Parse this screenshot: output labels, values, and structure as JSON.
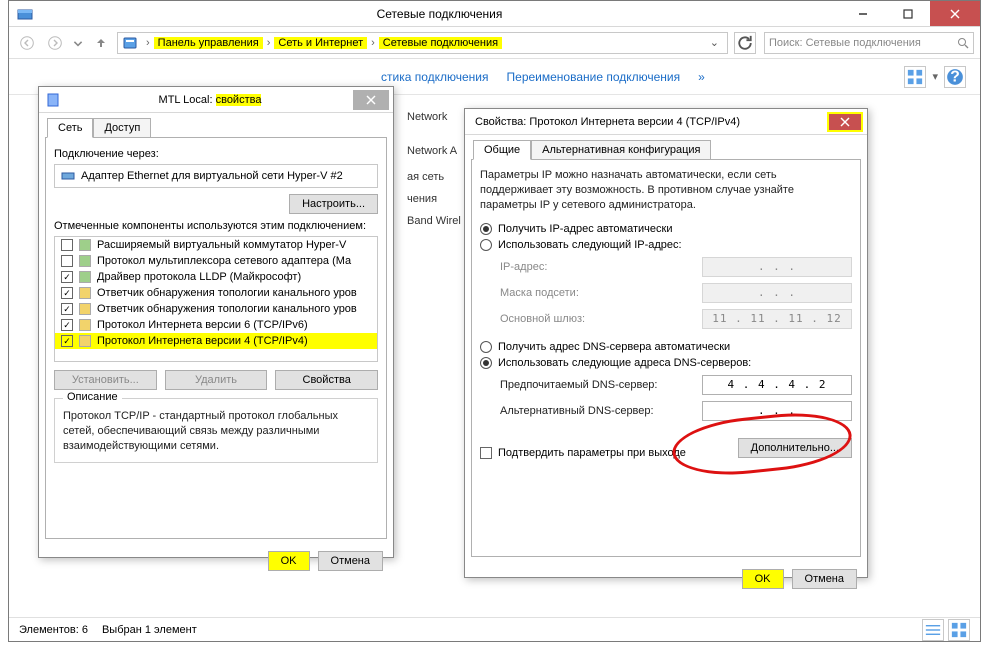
{
  "explorer": {
    "title": "Сетевые подключения",
    "breadcrumbs": [
      "Панель управления",
      "Сеть и Интернет",
      "Сетевые подключения"
    ],
    "search_placeholder": "Поиск: Сетевые подключения",
    "commands": {
      "diag_suffix": "стика подключения",
      "rename": "Переименование подключения"
    },
    "columns": {
      "c1": "Network",
      "c2": "Network A",
      "c3": "ая сеть",
      "c4": "чения",
      "c5": "Band Wirel"
    },
    "status": {
      "count": "Элементов: 6",
      "selected": "Выбран 1 элемент"
    }
  },
  "dlg1": {
    "title_prefix": "MTL Local: ",
    "title_hl": "свойства",
    "tabs": {
      "net": "Сеть",
      "access": "Доступ"
    },
    "connect_via": "Подключение через:",
    "adapter": "Адаптер Ethernet для виртуальной сети Hyper-V #2",
    "configure": "Настроить...",
    "components_label": "Отмеченные компоненты используются этим подключением:",
    "items": [
      {
        "checked": false,
        "style": "g",
        "label": "Расширяемый виртуальный коммутатор Hyper-V"
      },
      {
        "checked": false,
        "style": "g",
        "label": "Протокол мультиплексора сетевого адаптера (Ма"
      },
      {
        "checked": true,
        "style": "g",
        "label": "Драйвер протокола LLDP (Майкрософт)"
      },
      {
        "checked": true,
        "style": "y",
        "label": "Ответчик обнаружения топологии канального уров"
      },
      {
        "checked": true,
        "style": "y",
        "label": "Ответчик обнаружения топологии канального уров"
      },
      {
        "checked": true,
        "style": "y",
        "label": "Протокол Интернета версии 6 (TCP/IPv6)"
      },
      {
        "checked": true,
        "style": "y",
        "label": "Протокол Интернета версии 4 (TCP/IPv4)"
      }
    ],
    "install": "Установить...",
    "remove": "Удалить",
    "props": "Свойства",
    "desc_title": "Описание",
    "desc": "Протокол TCP/IP - стандартный протокол глобальных сетей, обеспечивающий связь между различными взаимодействующими сетями.",
    "ok": "OK",
    "cancel": "Отмена"
  },
  "dlg2": {
    "title": "Свойства: Протокол Интернета версии 4 (TCP/IPv4)",
    "tabs": {
      "general": "Общие",
      "alt": "Альтернативная конфигурация"
    },
    "intro": "Параметры IP можно назначать автоматически, если сеть поддерживает эту возможность. В противном случае узнайте параметры IP у сетевого администратора.",
    "r_ip_auto": "Получить IP-адрес автоматически",
    "r_ip_manual": "Использовать следующий IP-адрес:",
    "ip_label": "IP-адрес:",
    "mask_label": "Маска подсети:",
    "gw_label": "Основной шлюз:",
    "ip_val": ".       .       .",
    "mask_val": ".       .       .",
    "gw_val": "11 . 11 . 11 . 12",
    "r_dns_auto": "Получить адрес DNS-сервера автоматически",
    "r_dns_manual": "Использовать следующие адреса DNS-серверов:",
    "dns1_label": "Предпочитаемый DNS-сервер:",
    "dns2_label": "Альтернативный DNS-сервер:",
    "dns1_val": "4 .  4  .  4  .  2",
    "dns2_val": ".       .       .",
    "validate": "Подтвердить параметры при выходе",
    "advanced": "Дополнительно...",
    "ok": "OK",
    "cancel": "Отмена"
  }
}
